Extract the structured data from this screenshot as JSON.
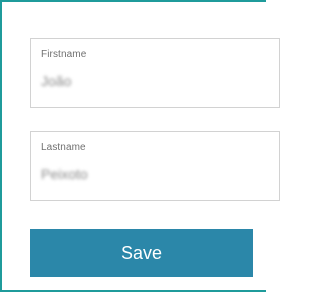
{
  "form": {
    "firstname": {
      "label": "Firstname",
      "value": "João"
    },
    "lastname": {
      "label": "Lastname",
      "value": "Peixoto"
    },
    "save_label": "Save"
  },
  "colors": {
    "frame_border": "#1f9b9b",
    "field_border": "#d2d2d2",
    "button_bg": "#2b87a9",
    "button_text": "#ffffff"
  }
}
